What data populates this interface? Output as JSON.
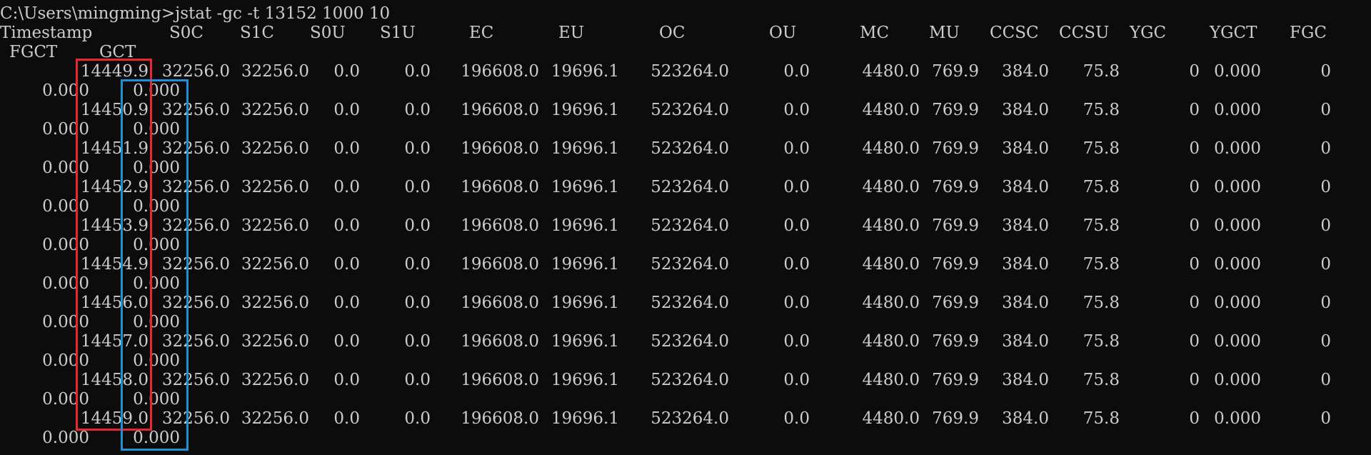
{
  "prompt": "C:\\Users\\mingming>jstat -gc -t 13152 1000 10",
  "headers": [
    "Timestamp",
    "S0C",
    "S1C",
    "S0U",
    "S1U",
    "EC",
    "EU",
    "OC",
    "OU",
    "MC",
    "MU",
    "CCSC",
    "CCSU",
    "YGC",
    "YGCT",
    "FGC"
  ],
  "headers_wrapped": [
    "FGCT",
    "GCT"
  ],
  "rows": [
    {
      "ts": "14449.9",
      "s0c": "32256.0",
      "s1c": "32256.0",
      "s0u": "0.0",
      "s1u": "0.0",
      "ec": "196608.0",
      "eu": "19696.1",
      "oc": "523264.0",
      "ou": "0.0",
      "mc": "4480.0",
      "mu": "769.9",
      "ccsc": "384.0",
      "ccsu": "75.8",
      "ygc": "0",
      "ygct": "0.000",
      "fgc": "0",
      "fgct": "0.000",
      "gct": "0.000"
    },
    {
      "ts": "14450.9",
      "s0c": "32256.0",
      "s1c": "32256.0",
      "s0u": "0.0",
      "s1u": "0.0",
      "ec": "196608.0",
      "eu": "19696.1",
      "oc": "523264.0",
      "ou": "0.0",
      "mc": "4480.0",
      "mu": "769.9",
      "ccsc": "384.0",
      "ccsu": "75.8",
      "ygc": "0",
      "ygct": "0.000",
      "fgc": "0",
      "fgct": "0.000",
      "gct": "0.000"
    },
    {
      "ts": "14451.9",
      "s0c": "32256.0",
      "s1c": "32256.0",
      "s0u": "0.0",
      "s1u": "0.0",
      "ec": "196608.0",
      "eu": "19696.1",
      "oc": "523264.0",
      "ou": "0.0",
      "mc": "4480.0",
      "mu": "769.9",
      "ccsc": "384.0",
      "ccsu": "75.8",
      "ygc": "0",
      "ygct": "0.000",
      "fgc": "0",
      "fgct": "0.000",
      "gct": "0.000"
    },
    {
      "ts": "14452.9",
      "s0c": "32256.0",
      "s1c": "32256.0",
      "s0u": "0.0",
      "s1u": "0.0",
      "ec": "196608.0",
      "eu": "19696.1",
      "oc": "523264.0",
      "ou": "0.0",
      "mc": "4480.0",
      "mu": "769.9",
      "ccsc": "384.0",
      "ccsu": "75.8",
      "ygc": "0",
      "ygct": "0.000",
      "fgc": "0",
      "fgct": "0.000",
      "gct": "0.000"
    },
    {
      "ts": "14453.9",
      "s0c": "32256.0",
      "s1c": "32256.0",
      "s0u": "0.0",
      "s1u": "0.0",
      "ec": "196608.0",
      "eu": "19696.1",
      "oc": "523264.0",
      "ou": "0.0",
      "mc": "4480.0",
      "mu": "769.9",
      "ccsc": "384.0",
      "ccsu": "75.8",
      "ygc": "0",
      "ygct": "0.000",
      "fgc": "0",
      "fgct": "0.000",
      "gct": "0.000"
    },
    {
      "ts": "14454.9",
      "s0c": "32256.0",
      "s1c": "32256.0",
      "s0u": "0.0",
      "s1u": "0.0",
      "ec": "196608.0",
      "eu": "19696.1",
      "oc": "523264.0",
      "ou": "0.0",
      "mc": "4480.0",
      "mu": "769.9",
      "ccsc": "384.0",
      "ccsu": "75.8",
      "ygc": "0",
      "ygct": "0.000",
      "fgc": "0",
      "fgct": "0.000",
      "gct": "0.000"
    },
    {
      "ts": "14456.0",
      "s0c": "32256.0",
      "s1c": "32256.0",
      "s0u": "0.0",
      "s1u": "0.0",
      "ec": "196608.0",
      "eu": "19696.1",
      "oc": "523264.0",
      "ou": "0.0",
      "mc": "4480.0",
      "mu": "769.9",
      "ccsc": "384.0",
      "ccsu": "75.8",
      "ygc": "0",
      "ygct": "0.000",
      "fgc": "0",
      "fgct": "0.000",
      "gct": "0.000"
    },
    {
      "ts": "14457.0",
      "s0c": "32256.0",
      "s1c": "32256.0",
      "s0u": "0.0",
      "s1u": "0.0",
      "ec": "196608.0",
      "eu": "19696.1",
      "oc": "523264.0",
      "ou": "0.0",
      "mc": "4480.0",
      "mu": "769.9",
      "ccsc": "384.0",
      "ccsu": "75.8",
      "ygc": "0",
      "ygct": "0.000",
      "fgc": "0",
      "fgct": "0.000",
      "gct": "0.000"
    },
    {
      "ts": "14458.0",
      "s0c": "32256.0",
      "s1c": "32256.0",
      "s0u": "0.0",
      "s1u": "0.0",
      "ec": "196608.0",
      "eu": "19696.1",
      "oc": "523264.0",
      "ou": "0.0",
      "mc": "4480.0",
      "mu": "769.9",
      "ccsc": "384.0",
      "ccsu": "75.8",
      "ygc": "0",
      "ygct": "0.000",
      "fgc": "0",
      "fgct": "0.000",
      "gct": "0.000"
    },
    {
      "ts": "14459.0",
      "s0c": "32256.0",
      "s1c": "32256.0",
      "s0u": "0.0",
      "s1u": "0.0",
      "ec": "196608.0",
      "eu": "19696.1",
      "oc": "523264.0",
      "ou": "0.0",
      "mc": "4480.0",
      "mu": "769.9",
      "ccsc": "384.0",
      "ccsu": "75.8",
      "ygc": "0",
      "ygct": "0.000",
      "fgc": "0",
      "fgct": "0.000",
      "gct": "0.000"
    }
  ],
  "highlight_colors": {
    "timestamp_box": "#e8282c",
    "gct_box": "#1f8fd6"
  },
  "colors": {
    "background": "#0c0c0c",
    "text": "#cccccc"
  }
}
